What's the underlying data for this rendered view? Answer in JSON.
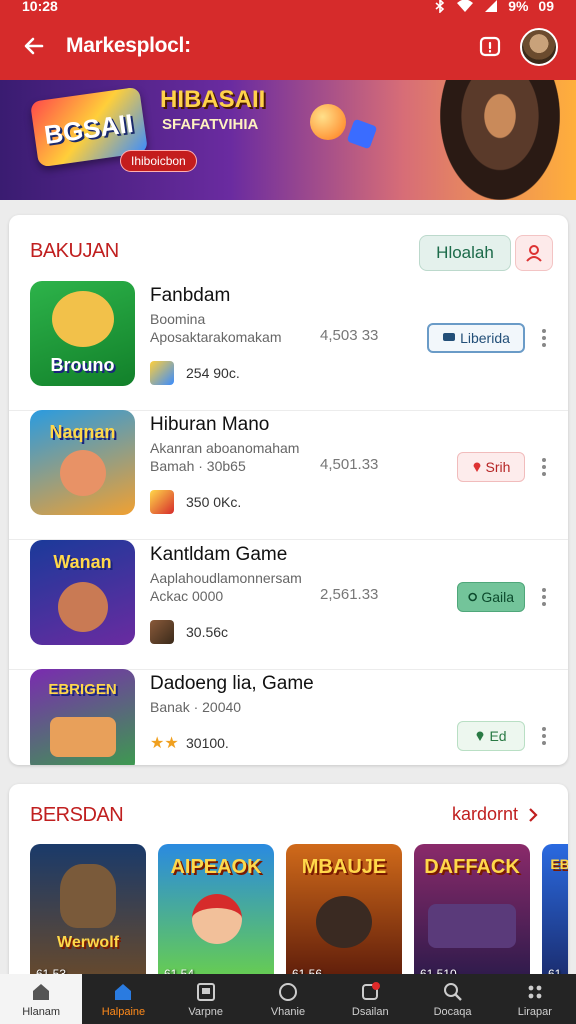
{
  "status": {
    "time": "10:28",
    "battery": "9%",
    "network": "09"
  },
  "header": {
    "title": "Markesplocl:"
  },
  "banner": {
    "logo": "BGSAII",
    "headline": "HIBASAII",
    "subtitle": "SFAFATVIHIA",
    "pill": "Ihiboicbon"
  },
  "section1": {
    "title": "BAKUJAN",
    "filter_label": "Hloalah",
    "items": [
      {
        "name": "Fanbdam",
        "desc1": "Boomina",
        "desc2": "Aposaktarakomakam",
        "count": "4,503 33",
        "meta": "254 90c.",
        "badge": "Liberida",
        "thumb_label": "Brouno"
      },
      {
        "name": "Hiburan Mano",
        "desc1": "Akanran aboanomaham",
        "desc2": "Bamah · 30b65",
        "count": "4,501.33",
        "meta": "350 0Kc.",
        "badge": "Srih",
        "thumb_label": "Naqnan"
      },
      {
        "name": "Kantldam Game",
        "desc1": "Aaplahoudlamonnersam",
        "desc2": "Ackac 0000",
        "count": "2,561.33",
        "meta": "30.56c",
        "badge": "Gaila",
        "thumb_label": "Wanan"
      },
      {
        "name": "Dadoeng lia, Game",
        "desc1": "Banak · 20040",
        "desc2": "",
        "count": "",
        "meta": "30100.",
        "badge": "Ed",
        "thumb_label": "EBRIGEN"
      }
    ]
  },
  "section2": {
    "title": "BERSDAN",
    "see_all": "kardornt",
    "tiles": [
      {
        "title": "Werwolf",
        "count": "61 53"
      },
      {
        "title": "AIPEAOK",
        "count": "61 54"
      },
      {
        "title": "MBAUJE",
        "count": "61 56"
      },
      {
        "title": "DAFFACK",
        "count": "61 510"
      },
      {
        "title": "EBI",
        "count": "61"
      }
    ]
  },
  "nav": [
    {
      "label": "Hlanam"
    },
    {
      "label": "Halpaine"
    },
    {
      "label": "Varpne"
    },
    {
      "label": "Vhanie"
    },
    {
      "label": "Dsailan"
    },
    {
      "label": "Docaqa"
    },
    {
      "label": "Lirapar"
    }
  ],
  "colors": {
    "primary": "#d62b2b",
    "accent": "#ff8a1a",
    "nav_bg": "#242424"
  }
}
